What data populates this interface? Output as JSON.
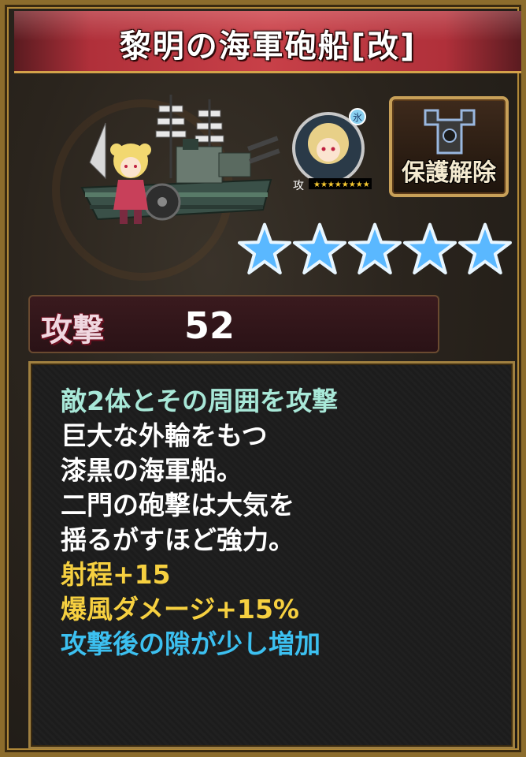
{
  "unit": {
    "name": "黎明の海軍砲船[改]",
    "element_badge": "氷",
    "role_badge": "攻",
    "rarity_stars": 5
  },
  "lock_button": {
    "label": "保護解除"
  },
  "stat": {
    "label": "攻撃",
    "value": "52"
  },
  "description": {
    "skill_line": "敵2体とその周囲を攻撃",
    "flavor_lines": [
      "巨大な外輪をもつ",
      "漆黒の海軍船。",
      "二門の砲撃は大気を",
      "揺るがすほど強力。"
    ],
    "bonus_lines": [
      "射程+15",
      "爆風ダメージ+15%"
    ],
    "penalty_line": "攻撃後の隙が少し増加"
  },
  "colors": {
    "title_bar": "#c84048",
    "frame_gold": "#b08838",
    "star_blue": "#5ab8ff",
    "skill_text": "#a8e8d8",
    "bonus_text": "#f6d040",
    "penalty_text": "#3cc0f0"
  },
  "icons": {
    "lock": "protection-lock-icon",
    "star": "rarity-star-icon"
  }
}
